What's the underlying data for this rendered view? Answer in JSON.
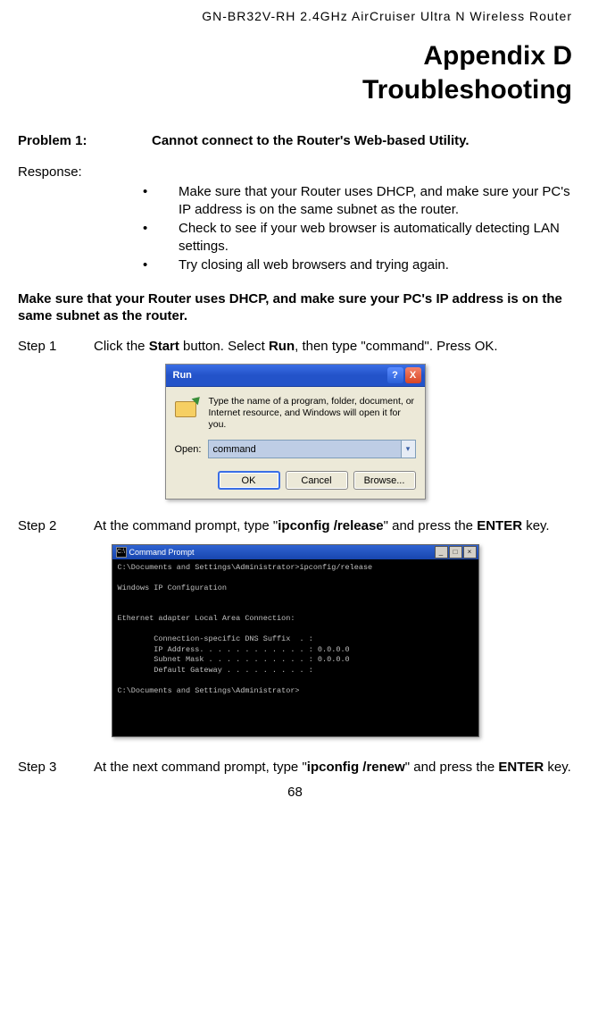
{
  "header": "GN-BR32V-RH  2.4GHz  AirCruiser  Ultra  N  Wireless  Router",
  "title_lines": {
    "l1": "Appendix D",
    "l2": "Troubleshooting"
  },
  "problem": {
    "label": "Problem 1:",
    "desc": "Cannot connect to the Router's Web-based Utility."
  },
  "response_label": "Response:",
  "bullets": [
    "Make sure that your Router uses DHCP, and make sure your PC's IP address is on the same subnet as the router.",
    "Check to see if your web browser is automatically detecting LAN settings.",
    "Try closing all web browsers and trying again."
  ],
  "subheading": "Make sure that your Router uses DHCP, and make sure your PC's IP address is on the same subnet as the router.",
  "step1": {
    "label": "Step 1",
    "pre": "Click the ",
    "b1": "Start",
    "mid1": " button. Select ",
    "b2": "Run",
    "post": ", then type \"command\". Press OK."
  },
  "run_dialog": {
    "title": "Run",
    "help_glyph": "?",
    "close_glyph": "X",
    "desc": "Type the name of a program, folder, document, or Internet resource, and Windows will open it for you.",
    "open_label": "Open:",
    "value": "command",
    "dd_glyph": "▾",
    "ok": "OK",
    "cancel": "Cancel",
    "browse": "Browse..."
  },
  "step2": {
    "label": "Step 2",
    "pre": "At the command prompt, type \"",
    "b1": "ipconfig /release",
    "mid": "\" and press the ",
    "b2": "ENTER",
    "post": " key."
  },
  "cmd": {
    "title": "Command Prompt",
    "icon_glyph": "C:\\",
    "min": "_",
    "max": "□",
    "close": "×",
    "lines": [
      "C:\\Documents and Settings\\Administrator>ipconfig/release",
      "",
      "Windows IP Configuration",
      "",
      "",
      "Ethernet adapter Local Area Connection:",
      "",
      "        Connection-specific DNS Suffix  . :",
      "        IP Address. . . . . . . . . . . . : 0.0.0.0",
      "        Subnet Mask . . . . . . . . . . . : 0.0.0.0",
      "        Default Gateway . . . . . . . . . :",
      "",
      "C:\\Documents and Settings\\Administrator>"
    ]
  },
  "step3": {
    "label": "Step 3",
    "pre": "At the next command prompt, type \"",
    "b1": "ipconfig /renew",
    "mid": "\" and press the ",
    "b2": "ENTER",
    "post": " key."
  },
  "page_num": "68"
}
